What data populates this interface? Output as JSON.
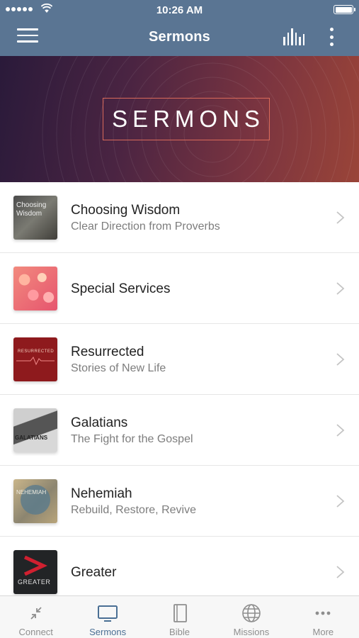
{
  "status_bar": {
    "time": "10:26 AM"
  },
  "nav": {
    "title": "Sermons",
    "menu_icon": "hamburger-icon",
    "stats_icon": "bar-chart-icon",
    "more_icon": "vertical-dots-icon",
    "bar_color": "#5a7593"
  },
  "banner": {
    "text": "SERMONS"
  },
  "list": [
    {
      "title": "Choosing Wisdom",
      "subtitle": "Clear Direction from Proverbs",
      "thumb_text": "Choosing Wisdom"
    },
    {
      "title": "Special Services",
      "subtitle": "",
      "thumb_text": ""
    },
    {
      "title": "Resurrected",
      "subtitle": "Stories of New Life",
      "thumb_text": "RESURRECTED"
    },
    {
      "title": "Galatians",
      "subtitle": "The Fight for the Gospel",
      "thumb_text": "GALATIANS"
    },
    {
      "title": "Nehemiah",
      "subtitle": "Rebuild, Restore, Revive",
      "thumb_text": "NEHEMIAH"
    },
    {
      "title": "Greater",
      "subtitle": "",
      "thumb_text": "GREATER"
    }
  ],
  "tabs": [
    {
      "label": "Connect",
      "icon": "collapse-arrows-icon"
    },
    {
      "label": "Sermons",
      "icon": "tv-icon",
      "active": true
    },
    {
      "label": "Bible",
      "icon": "book-icon"
    },
    {
      "label": "Missions",
      "icon": "globe-icon"
    },
    {
      "label": "More",
      "icon": "horizontal-dots-icon"
    }
  ],
  "colors": {
    "accent": "#4a6f94",
    "inactive": "#8e8e8e"
  }
}
